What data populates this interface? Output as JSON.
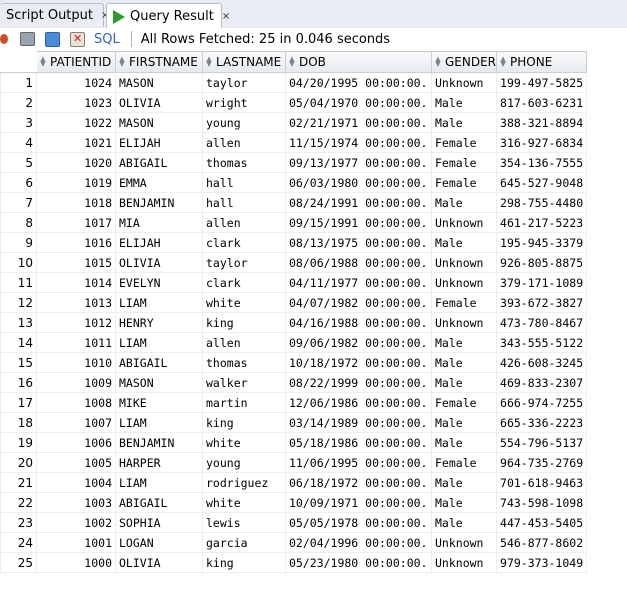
{
  "tabs": [
    {
      "label": "Script Output",
      "close": "×"
    },
    {
      "label": "Query Result",
      "close": "×"
    }
  ],
  "toolbar": {
    "sql_label": "SQL",
    "status": "All Rows Fetched: 25 in 0.046 seconds"
  },
  "columns": [
    "PATIENTID",
    "FIRSTNAME",
    "LASTNAME",
    "DOB",
    "GENDER",
    "PHONE"
  ],
  "rows": [
    [
      "1",
      "1024",
      "MASON",
      "taylor",
      "04/20/1995 00:00:00.",
      "Unknown",
      "199-497-5825"
    ],
    [
      "2",
      "1023",
      "OLIVIA",
      "wright",
      "05/04/1970 00:00:00.",
      "Male",
      "817-603-6231"
    ],
    [
      "3",
      "1022",
      "MASON",
      "young",
      "02/21/1971 00:00:00.",
      "Male",
      "388-321-8894"
    ],
    [
      "4",
      "1021",
      "ELIJAH",
      "allen",
      "11/15/1974 00:00:00.",
      "Female",
      "316-927-6834"
    ],
    [
      "5",
      "1020",
      "ABIGAIL",
      "thomas",
      "09/13/1977 00:00:00.",
      "Female",
      "354-136-7555"
    ],
    [
      "6",
      "1019",
      "EMMA",
      "hall",
      "06/03/1980 00:00:00.",
      "Female",
      "645-527-9048"
    ],
    [
      "7",
      "1018",
      "BENJAMIN",
      "hall",
      "08/24/1991 00:00:00.",
      "Male",
      "298-755-4480"
    ],
    [
      "8",
      "1017",
      "MIA",
      "allen",
      "09/15/1991 00:00:00.",
      "Unknown",
      "461-217-5223"
    ],
    [
      "9",
      "1016",
      "ELIJAH",
      "clark",
      "08/13/1975 00:00:00.",
      "Male",
      "195-945-3379"
    ],
    [
      "10",
      "1015",
      "OLIVIA",
      "taylor",
      "08/06/1988 00:00:00.",
      "Unknown",
      "926-805-8875"
    ],
    [
      "11",
      "1014",
      "EVELYN",
      "clark",
      "04/11/1977 00:00:00.",
      "Unknown",
      "379-171-1089"
    ],
    [
      "12",
      "1013",
      "LIAM",
      "white",
      "04/07/1982 00:00:00.",
      "Female",
      "393-672-3827"
    ],
    [
      "13",
      "1012",
      "HENRY",
      "king",
      "04/16/1988 00:00:00.",
      "Unknown",
      "473-780-8467"
    ],
    [
      "14",
      "1011",
      "LIAM",
      "allen",
      "09/06/1982 00:00:00.",
      "Male",
      "343-555-5122"
    ],
    [
      "15",
      "1010",
      "ABIGAIL",
      "thomas",
      "10/18/1972 00:00:00.",
      "Male",
      "426-608-3245"
    ],
    [
      "16",
      "1009",
      "MASON",
      "walker",
      "08/22/1999 00:00:00.",
      "Male",
      "469-833-2307"
    ],
    [
      "17",
      "1008",
      "MIKE",
      "martin",
      "12/06/1986 00:00:00.",
      "Female",
      "666-974-7255"
    ],
    [
      "18",
      "1007",
      "LIAM",
      "king",
      "03/14/1989 00:00:00.",
      "Male",
      "665-336-2223"
    ],
    [
      "19",
      "1006",
      "BENJAMIN",
      "white",
      "05/18/1986 00:00:00.",
      "Male",
      "554-796-5137"
    ],
    [
      "20",
      "1005",
      "HARPER",
      "young",
      "11/06/1995 00:00:00.",
      "Female",
      "964-735-2769"
    ],
    [
      "21",
      "1004",
      "LIAM",
      "rodriguez",
      "06/18/1972 00:00:00.",
      "Male",
      "701-618-9463"
    ],
    [
      "22",
      "1003",
      "ABIGAIL",
      "white",
      "10/09/1971 00:00:00.",
      "Male",
      "743-598-1098"
    ],
    [
      "23",
      "1002",
      "SOPHIA",
      "lewis",
      "05/05/1978 00:00:00.",
      "Male",
      "447-453-5405"
    ],
    [
      "24",
      "1001",
      "LOGAN",
      "garcia",
      "02/04/1996 00:00:00.",
      "Unknown",
      "546-877-8602"
    ],
    [
      "25",
      "1000",
      "OLIVIA",
      "king",
      "05/23/1980 00:00:00.",
      "Unknown",
      "979-373-1049"
    ]
  ]
}
